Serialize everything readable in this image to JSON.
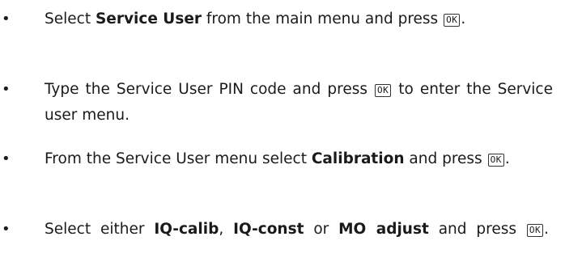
{
  "bullet_glyph": "•",
  "key_label": "OK",
  "steps": [
    {
      "t1": "Select ",
      "b1": "Service User",
      "t2": " from the main menu and press "
    },
    {
      "t1": "Type the Service User PIN code and press ",
      "t2": " to enter the Service user menu."
    },
    {
      "t1": "From the Service User menu select ",
      "b1": "Calibration",
      "t2": " and press "
    },
    {
      "t1": "Select either ",
      "b1": "IQ-calib",
      "t2": ", ",
      "b2": "IQ-const",
      "t3": " or ",
      "b3": "MO adjust",
      "t4": " and press "
    }
  ],
  "end_punct": "."
}
